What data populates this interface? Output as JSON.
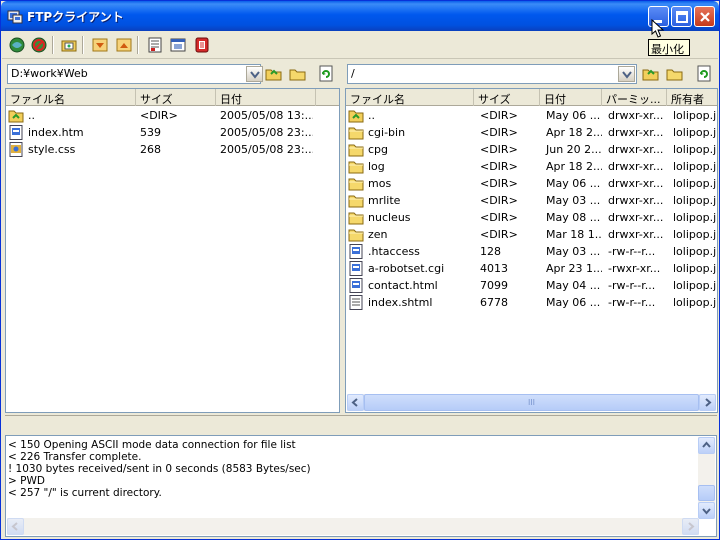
{
  "window": {
    "title": "FTPクライアント",
    "tooltip": "最小化"
  },
  "toolbar": {
    "buttons": [
      "connect-icon",
      "disconnect-icon",
      "site-manager-icon",
      "download-icon",
      "upload-icon",
      "log-icon",
      "queue-icon",
      "stop-icon"
    ]
  },
  "local": {
    "path": "D:¥work¥Web",
    "columns": [
      "ファイル名",
      "サイズ",
      "日付"
    ],
    "files": [
      {
        "name": "..",
        "size": "<DIR>",
        "date": "2005/05/08 13:...",
        "icon": "parent-folder-icon"
      },
      {
        "name": "index.htm",
        "size": "539",
        "date": "2005/05/08 23:...",
        "icon": "html-file-icon"
      },
      {
        "name": "style.css",
        "size": "268",
        "date": "2005/05/08 23:...",
        "icon": "css-file-icon"
      }
    ]
  },
  "remote": {
    "path": "/",
    "columns": [
      "ファイル名",
      "サイズ",
      "日付",
      "パーミッ...",
      "所有者"
    ],
    "files": [
      {
        "name": "..",
        "size": "<DIR>",
        "date": "May 06 ...",
        "perm": "drwxr-xr...",
        "owner": "lolipop.jp",
        "icon": "parent-folder-icon"
      },
      {
        "name": "cgi-bin",
        "size": "<DIR>",
        "date": "Apr 18 2...",
        "perm": "drwxr-xr...",
        "owner": "lolipop.jp",
        "icon": "folder-icon"
      },
      {
        "name": "cpg",
        "size": "<DIR>",
        "date": "Jun 20 2...",
        "perm": "drwxr-xr...",
        "owner": "lolipop.jp",
        "icon": "folder-icon"
      },
      {
        "name": "log",
        "size": "<DIR>",
        "date": "Apr 18 2...",
        "perm": "drwxr-xr...",
        "owner": "lolipop.jp",
        "icon": "folder-icon"
      },
      {
        "name": "mos",
        "size": "<DIR>",
        "date": "May 06 ...",
        "perm": "drwxr-xr...",
        "owner": "lolipop.jp",
        "icon": "folder-icon"
      },
      {
        "name": "mrlite",
        "size": "<DIR>",
        "date": "May 03 ...",
        "perm": "drwxr-xr...",
        "owner": "lolipop.jp",
        "icon": "folder-icon"
      },
      {
        "name": "nucleus",
        "size": "<DIR>",
        "date": "May 08 ...",
        "perm": "drwxr-xr...",
        "owner": "lolipop.jp",
        "icon": "folder-icon"
      },
      {
        "name": "zen",
        "size": "<DIR>",
        "date": "Mar 18 1...",
        "perm": "drwxr-xr...",
        "owner": "lolipop.jp",
        "icon": "folder-icon"
      },
      {
        "name": ".htaccess",
        "size": "128",
        "date": "May 03 ...",
        "perm": "-rw-r--r...",
        "owner": "lolipop.jp",
        "icon": "html-file-icon"
      },
      {
        "name": "a-robotset.cgi",
        "size": "4013",
        "date": "Apr 23 1...",
        "perm": "-rwxr-xr...",
        "owner": "lolipop.jp",
        "icon": "html-file-icon"
      },
      {
        "name": "contact.html",
        "size": "7099",
        "date": "May 04 ...",
        "perm": "-rw-r--r...",
        "owner": "lolipop.jp",
        "icon": "html-file-icon"
      },
      {
        "name": "index.shtml",
        "size": "6778",
        "date": "May 06 ...",
        "perm": "-rw-r--r...",
        "owner": "lolipop.jp",
        "icon": "text-file-icon"
      }
    ]
  },
  "log": {
    "lines": [
      "< 150 Opening ASCII mode data connection for file list",
      "< 226 Transfer complete.",
      "! 1030 bytes received/sent in 0 seconds (8583 Bytes/sec)",
      "> PWD",
      "< 257 \"/\" is current directory."
    ]
  },
  "scroll": {
    "thumb_glyph": "III"
  }
}
